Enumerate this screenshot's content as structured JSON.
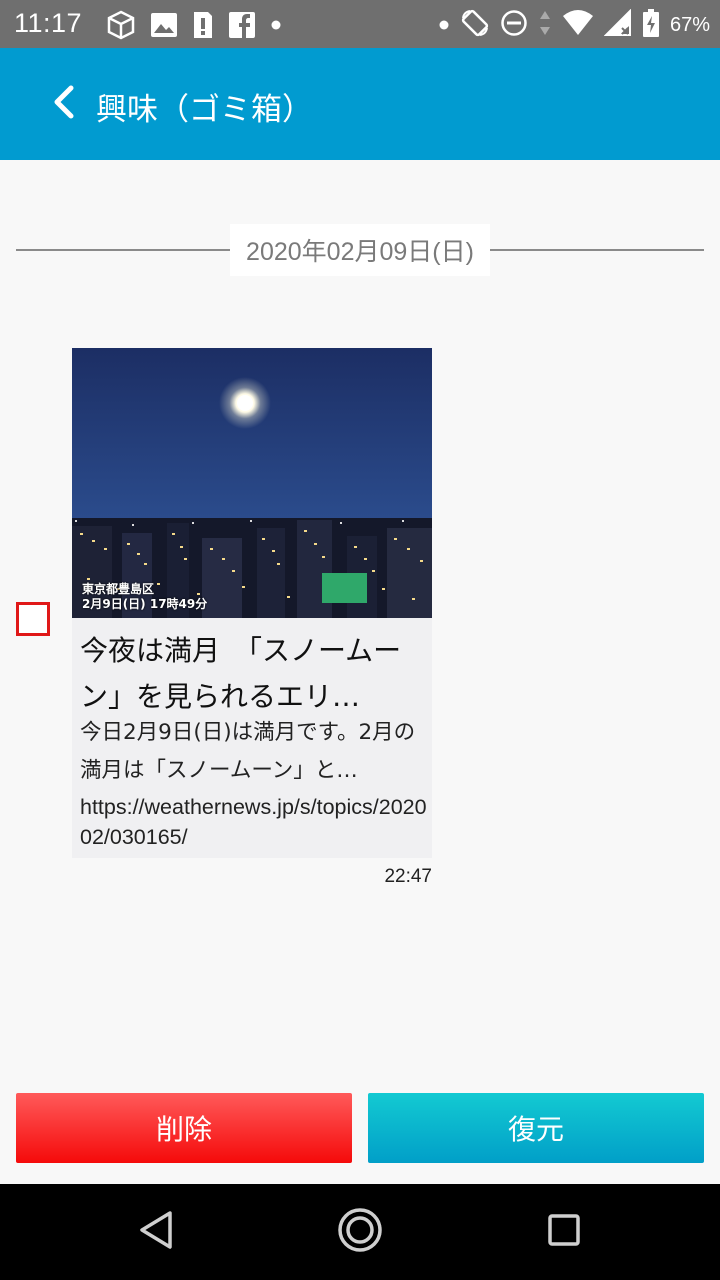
{
  "status_bar": {
    "time": "11:17",
    "battery_percent": "67%",
    "left_icons": [
      "storage-icon",
      "image-icon",
      "sd-alert-icon",
      "facebook-icon",
      "dot-icon"
    ],
    "right_icons": [
      "dot-icon",
      "rotate-icon",
      "do-not-disturb-icon",
      "data-arrows-icon",
      "wifi-icon",
      "signal-icon",
      "battery-charging-icon"
    ]
  },
  "app_bar": {
    "back_icon": "chevron-left-icon",
    "title": "興味（ゴミ箱）",
    "background": "#019bd0"
  },
  "date_separator": {
    "label": "2020年02月09日(日)"
  },
  "item": {
    "checked": false,
    "thumbnail_caption_line1": "東京都豊島区",
    "thumbnail_caption_line2": "2月9日(日) 17時49分",
    "title": "今夜は満月　「スノームーン」を見られるエリ…",
    "description": "今日2月9日(日)は満月です。2月の満月は「スノームーン」と…",
    "url": "https://weathernews.jp/s/topics/202002/030165/",
    "time": "22:47"
  },
  "actions": {
    "delete_label": "削除",
    "restore_label": "復元",
    "delete_color": "#ff2a2a",
    "restore_color": "#05b5cd"
  },
  "nav": {
    "icons": [
      "back-triangle-icon",
      "home-circle-icon",
      "recents-square-icon"
    ]
  }
}
